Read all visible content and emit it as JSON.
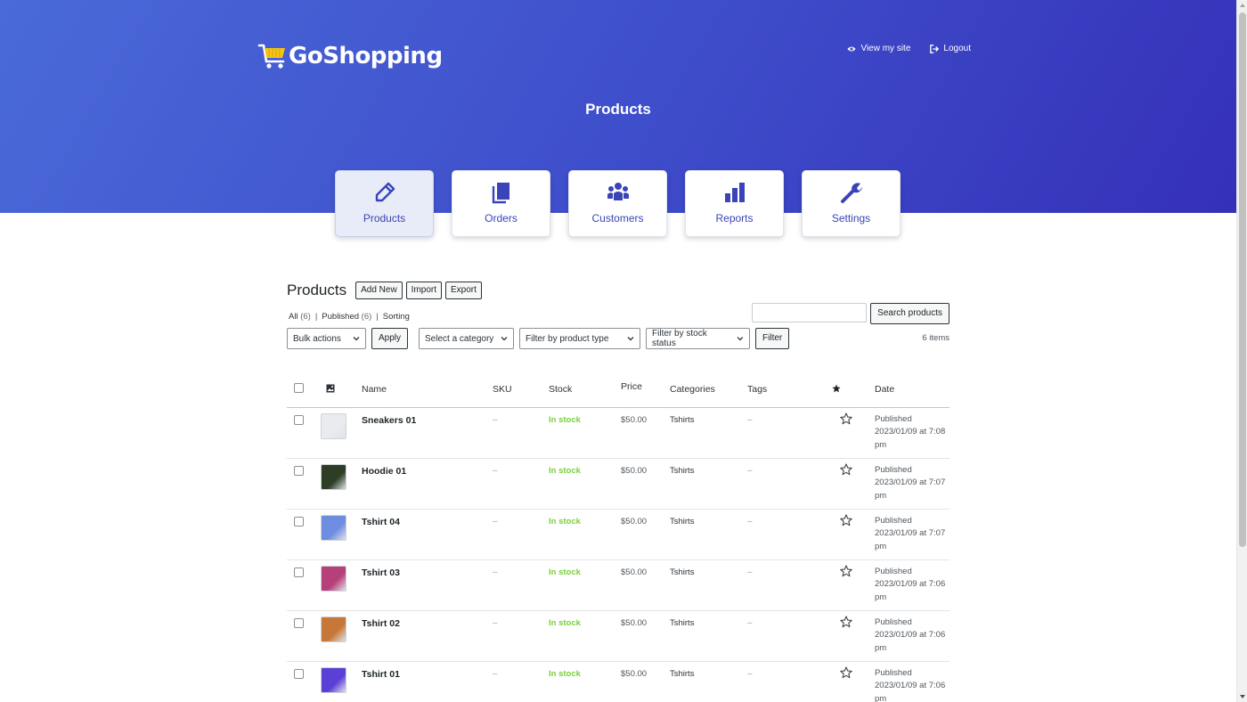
{
  "brand": {
    "name": "GoShopping"
  },
  "header": {
    "view_site": "View my site",
    "logout": "Logout",
    "title": "Products"
  },
  "nav": [
    {
      "label": "Products",
      "icon": "pencil-icon",
      "active": true
    },
    {
      "label": "Orders",
      "icon": "copy-icon",
      "active": false
    },
    {
      "label": "Customers",
      "icon": "users-icon",
      "active": false
    },
    {
      "label": "Reports",
      "icon": "bar-chart-icon",
      "active": false
    },
    {
      "label": "Settings",
      "icon": "wrench-icon",
      "active": false
    }
  ],
  "products_page": {
    "heading": "Products",
    "add_new": "Add New",
    "import": "Import",
    "export": "Export",
    "views": {
      "all": "All",
      "all_count": "(6)",
      "published": "Published",
      "published_count": "(6)",
      "sorting": "Sorting",
      "sep": "|"
    },
    "search": {
      "placeholder": "",
      "button": "Search products"
    },
    "bulk_actions": "Bulk actions",
    "apply": "Apply",
    "category_filter": "Select a category",
    "type_filter": "Filter by product type",
    "stock_filter": "Filter by stock status",
    "filter": "Filter",
    "items_count": "6 items"
  },
  "table": {
    "columns": {
      "name": "Name",
      "sku": "SKU",
      "stock": "Stock",
      "price": "Price",
      "categories": "Categories",
      "tags": "Tags",
      "date": "Date"
    },
    "rows": [
      {
        "name": "Sneakers 01",
        "sku": "–",
        "stock": "In stock",
        "price": "$50.00",
        "category": "Tshirts",
        "tags": "–",
        "date_status": "Published",
        "date_value": "2023/01/09 at 7:08",
        "date_ampm": "pm",
        "thumb_color": "#e9ebee"
      },
      {
        "name": "Hoodie 01",
        "sku": "–",
        "stock": "In stock",
        "price": "$50.00",
        "category": "Tshirts",
        "tags": "–",
        "date_status": "Published",
        "date_value": "2023/01/09 at 7:07",
        "date_ampm": "pm",
        "thumb_color": "#2d3d26"
      },
      {
        "name": "Tshirt 04",
        "sku": "–",
        "stock": "In stock",
        "price": "$50.00",
        "category": "Tshirts",
        "tags": "–",
        "date_status": "Published",
        "date_value": "2023/01/09 at 7:07",
        "date_ampm": "pm",
        "thumb_color": "#6d8de0"
      },
      {
        "name": "Tshirt 03",
        "sku": "–",
        "stock": "In stock",
        "price": "$50.00",
        "category": "Tshirts",
        "tags": "–",
        "date_status": "Published",
        "date_value": "2023/01/09 at 7:06",
        "date_ampm": "pm",
        "thumb_color": "#b8407a"
      },
      {
        "name": "Tshirt 02",
        "sku": "–",
        "stock": "In stock",
        "price": "$50.00",
        "category": "Tshirts",
        "tags": "–",
        "date_status": "Published",
        "date_value": "2023/01/09 at 7:06",
        "date_ampm": "pm",
        "thumb_color": "#c77838"
      },
      {
        "name": "Tshirt 01",
        "sku": "–",
        "stock": "In stock",
        "price": "$50.00",
        "category": "Tshirts",
        "tags": "–",
        "date_status": "Published",
        "date_value": "2023/01/09 at 7:06",
        "date_ampm": "pm",
        "thumb_color": "#5b3fd6"
      }
    ]
  },
  "colors": {
    "accent": "#3a44b8",
    "in_stock": "#7ad03a",
    "hero_start": "#4a6ad8",
    "hero_end": "#3530b8",
    "logo_cart": "#f5c518"
  }
}
